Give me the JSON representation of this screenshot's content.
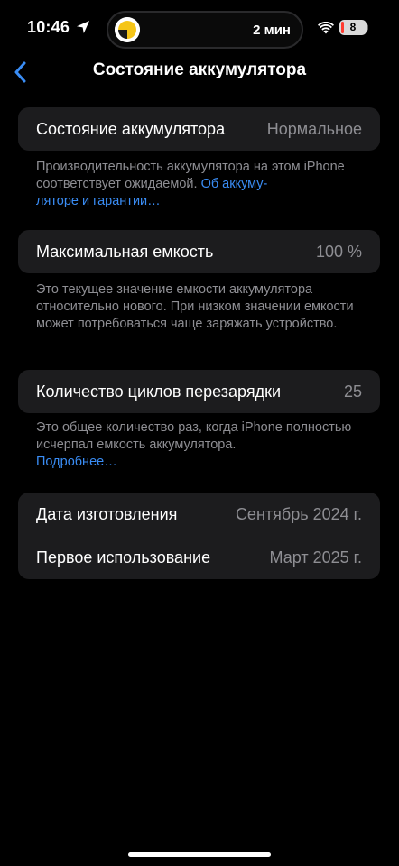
{
  "status_bar": {
    "time": "10:46",
    "live_activity_text": "2 мин",
    "battery_level": "8",
    "battery_fraction": 0.08,
    "battery_color": "#ff3b30"
  },
  "nav": {
    "back_icon": "chevron-left-icon",
    "title": "Состояние аккумулятора"
  },
  "battery_health": {
    "label": "Состояние аккумулятора",
    "value": "Нормальное",
    "footer_text": "Производительность аккумулятора на этом iPhone соответствует ожидаемой.",
    "footer_link_line1": "Об аккуму-",
    "footer_link_line2": "ляторе и гарантии…"
  },
  "max_capacity": {
    "label": "Максимальная емкость",
    "value": "100 %",
    "footer_text": "Это текущее значение емкости аккумулятора относительно нового. При низком значении емкости может потребоваться чаще заряжать устройство."
  },
  "cycle_count": {
    "label": "Количество циклов перезарядки",
    "value": "25",
    "footer_text": "Это общее количество раз, когда iPhone полностью исчерпал емкость аккумулятора.",
    "footer_link": "Подробнее…"
  },
  "dates": {
    "manufacture_label": "Дата изготовления",
    "manufacture_value": "Сентябрь 2024 г.",
    "first_use_label": "Первое использование",
    "first_use_value": "Март 2025 г."
  },
  "colors": {
    "background": "#000000",
    "card": "#1c1c1e",
    "accent": "#3a8df5",
    "secondary_text": "#8e8e93"
  }
}
